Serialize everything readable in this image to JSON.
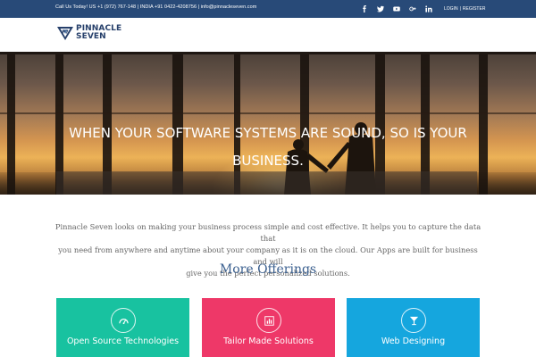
{
  "topbar": {
    "contact": "Call Us Today! US +1 (972) 767-148 | INDIA +91 0422-4208756 | info@pinnacleseven.com",
    "social_icons": [
      "facebook-icon",
      "twitter-icon",
      "youtube-icon",
      "google-plus-icon",
      "linkedin-icon"
    ],
    "login": "LOGIN",
    "separator": "|",
    "register": "REGISTER"
  },
  "logo": {
    "line1": "PINNACLE",
    "line2": "SEVEN"
  },
  "hero": {
    "line1": "WHEN YOUR SOFTWARE SYSTEMS ARE SOUND, SO IS YOUR",
    "line2": "BUSINESS."
  },
  "intro": {
    "line1": "Pinnacle Seven looks on making your business process simple and cost effective. It helps you to capture the data that",
    "line2": "you need from anywhere and anytime about your company as it is on the cloud. Our Apps are built for business and will",
    "line3": "give you the perfect personalized solutions."
  },
  "offerings": {
    "title": "More Offerings",
    "cards": [
      {
        "label": "Open Source Technologies",
        "icon": "dashboard-icon",
        "color": "#18c2a0"
      },
      {
        "label": "Tailor Made Solutions",
        "icon": "bar-chart-icon",
        "color": "#ee3868"
      },
      {
        "label": "Web Designing",
        "icon": "glass-icon",
        "color": "#15a6de"
      }
    ]
  },
  "colors": {
    "topbar": "#284a78",
    "brand": "#27406b",
    "heading": "#3a5f8f"
  }
}
